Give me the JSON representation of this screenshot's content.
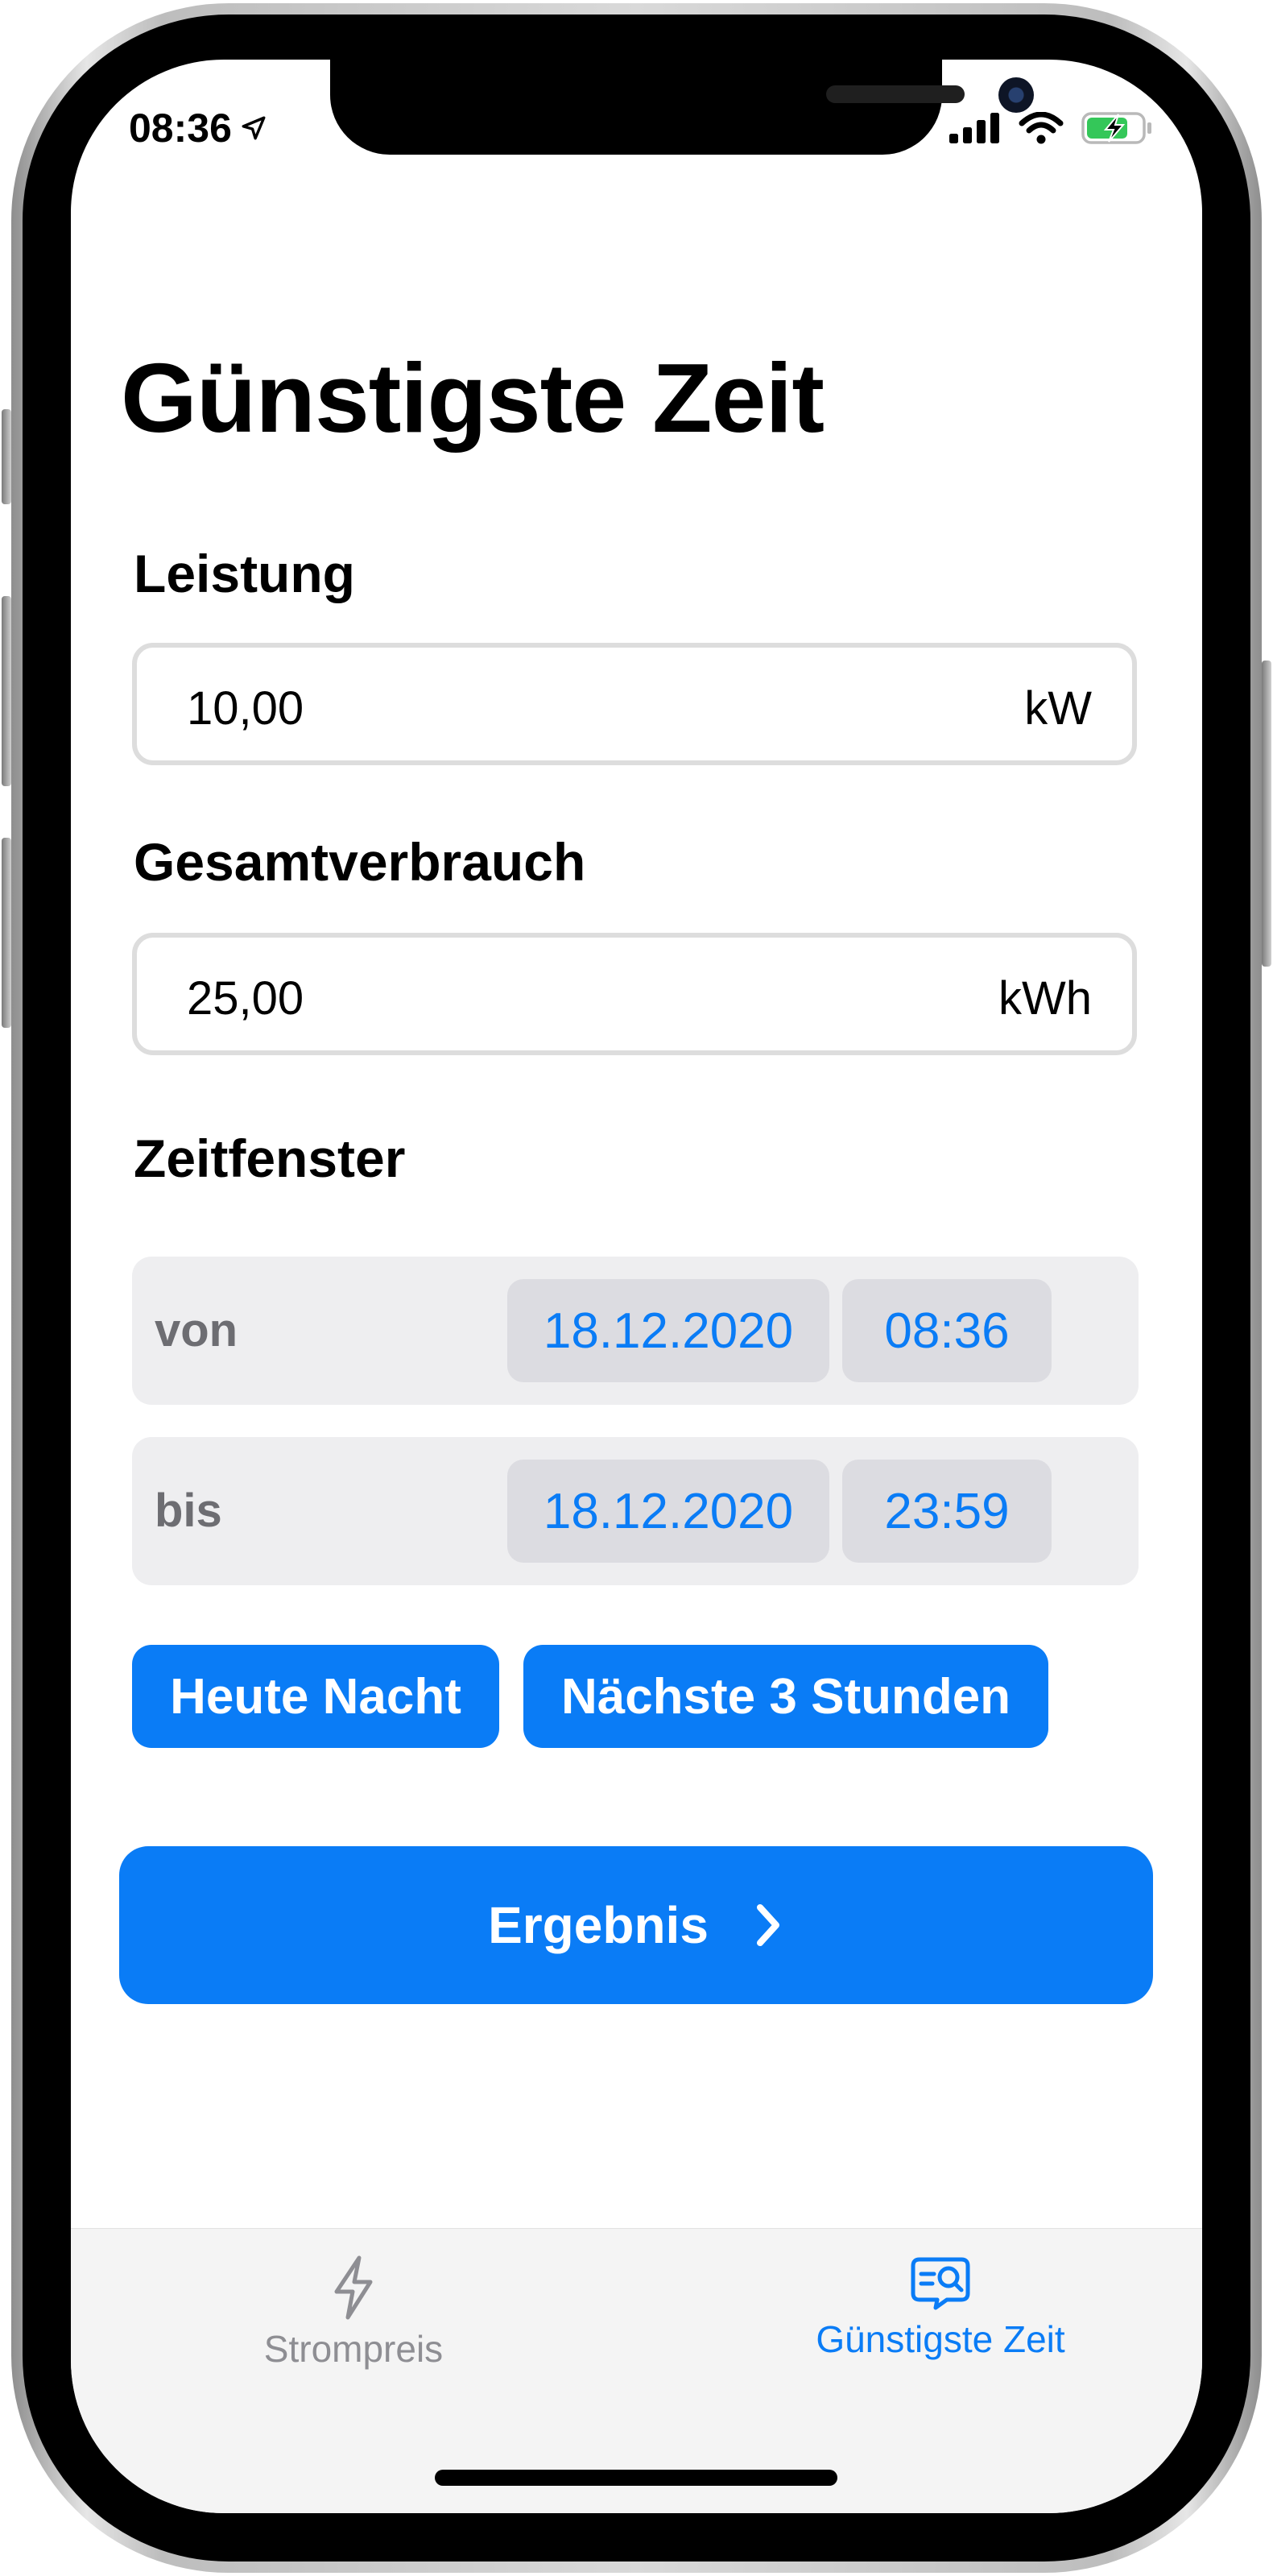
{
  "status_bar": {
    "time": "08:36"
  },
  "page": {
    "title": "Günstigste Zeit"
  },
  "power": {
    "label": "Leistung",
    "value": "10,00",
    "unit": "kW"
  },
  "consumption": {
    "label": "Gesamtverbrauch",
    "value": "25,00",
    "unit": "kWh"
  },
  "time_window": {
    "label": "Zeitfenster",
    "from": {
      "label": "von",
      "date": "18.12.2020",
      "time": "08:36"
    },
    "to": {
      "label": "bis",
      "date": "18.12.2020",
      "time": "23:59"
    }
  },
  "presets": {
    "tonight": "Heute Nacht",
    "next_3h": "Nächste 3 Stunden"
  },
  "result_button": {
    "label": "Ergebnis"
  },
  "tabbar": {
    "items": [
      {
        "label": "Strompreis",
        "icon": "bolt-icon",
        "selected": false
      },
      {
        "label": "Günstigste Zeit",
        "icon": "search-list-icon",
        "selected": true
      }
    ]
  },
  "colors": {
    "accent": "#0a7cf6",
    "inactive": "#8e8e93",
    "field_border": "#dddddd",
    "row_bg": "#eeeef0"
  }
}
